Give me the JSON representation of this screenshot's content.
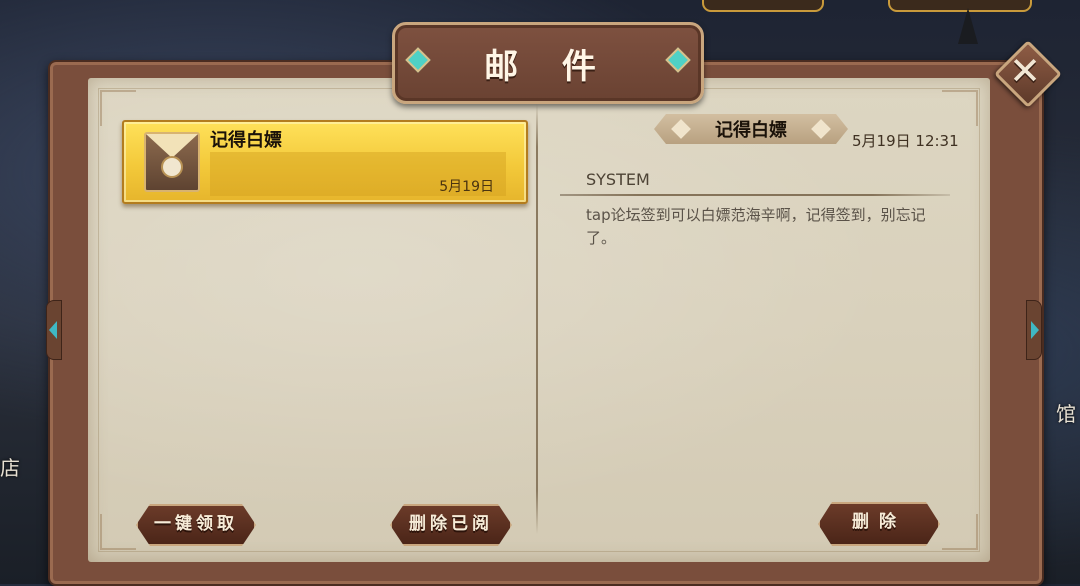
{
  "window": {
    "title": "邮 件"
  },
  "background": {
    "left_label": "店",
    "right_label": "馆"
  },
  "mail_list": [
    {
      "subject": "记得白嫖",
      "date": "5月19日",
      "selected": true
    }
  ],
  "detail": {
    "subject": "记得白嫖",
    "time": "5月19日 12:31",
    "sender": "SYSTEM",
    "body": "tap论坛签到可以白嫖范海辛啊，记得签到，别忘记了。"
  },
  "buttons": {
    "claim_all": "一键领取",
    "delete_read": "删除已阅",
    "delete": "删除"
  },
  "icons": {
    "close": "close-icon",
    "mail": "envelope-icon",
    "arrow_left": "arrow-left-icon",
    "arrow_right": "arrow-right-icon"
  },
  "colors": {
    "frame": "#7a4e3c",
    "paper": "#d9d1bc",
    "selected_item": "#f3c93a",
    "button": "#5a2f20",
    "accent_gem": "#4fd1c5"
  }
}
